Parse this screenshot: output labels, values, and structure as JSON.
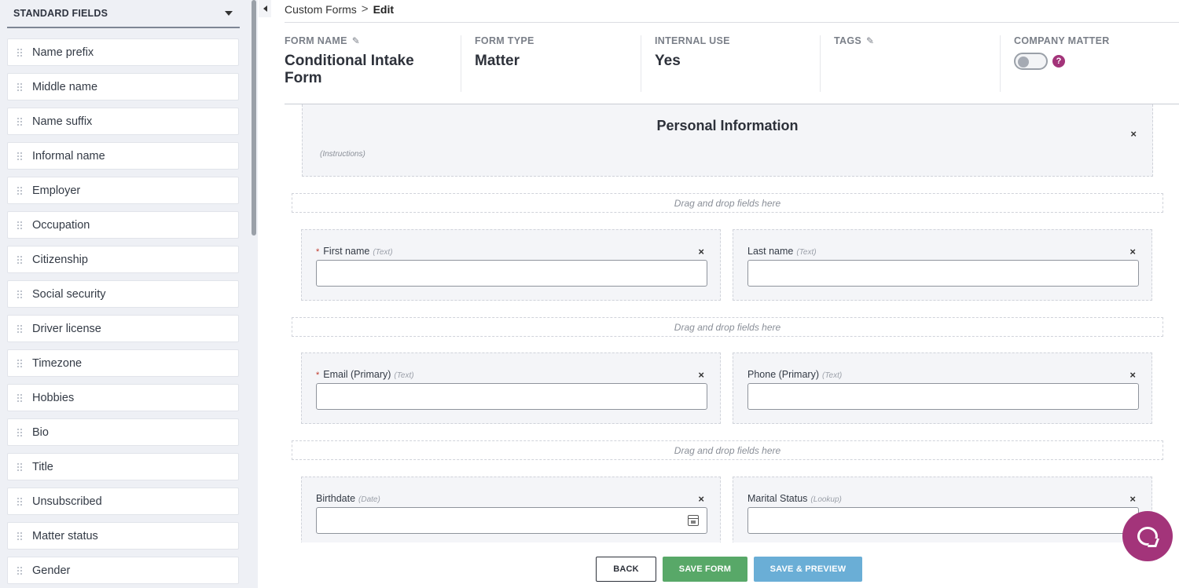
{
  "sidebar": {
    "title": "STANDARD FIELDS",
    "items": [
      {
        "label": "Name prefix"
      },
      {
        "label": "Middle name"
      },
      {
        "label": "Name suffix"
      },
      {
        "label": "Informal name"
      },
      {
        "label": "Employer"
      },
      {
        "label": "Occupation"
      },
      {
        "label": "Citizenship"
      },
      {
        "label": "Social security"
      },
      {
        "label": "Driver license"
      },
      {
        "label": "Timezone"
      },
      {
        "label": "Hobbies"
      },
      {
        "label": "Bio"
      },
      {
        "label": "Title"
      },
      {
        "label": "Unsubscribed"
      },
      {
        "label": "Matter status"
      },
      {
        "label": "Gender"
      }
    ]
  },
  "breadcrumb": {
    "parent": "Custom Forms",
    "separator": ">",
    "current": "Edit"
  },
  "meta": {
    "form_name": {
      "label": "FORM NAME",
      "value": "Conditional Intake Form"
    },
    "form_type": {
      "label": "FORM TYPE",
      "value": "Matter"
    },
    "internal_use": {
      "label": "INTERNAL USE",
      "value": "Yes"
    },
    "tags": {
      "label": "TAGS",
      "value": ""
    },
    "company_matter": {
      "label": "COMPANY MATTER",
      "enabled": false
    }
  },
  "section": {
    "title": "Personal Information",
    "instructions": "(Instructions)"
  },
  "dropzone_text": "Drag and drop fields here",
  "fields": {
    "first_name": {
      "label": "First name",
      "type": "(Text)",
      "required": "*"
    },
    "last_name": {
      "label": "Last name",
      "type": "(Text)"
    },
    "email": {
      "label": "Email (Primary)",
      "type": "(Text)",
      "required": "*"
    },
    "phone": {
      "label": "Phone (Primary)",
      "type": "(Text)"
    },
    "birthdate": {
      "label": "Birthdate",
      "type": "(Date)"
    },
    "marital_status": {
      "label": "Marital Status",
      "type": "(Lookup)"
    }
  },
  "close_glyph": "×",
  "footer": {
    "back": "BACK",
    "save": "SAVE FORM",
    "save_preview": "SAVE & PREVIEW"
  },
  "colors": {
    "brand": "#a3347a",
    "save": "#58a868",
    "preview": "#6aaed6"
  }
}
